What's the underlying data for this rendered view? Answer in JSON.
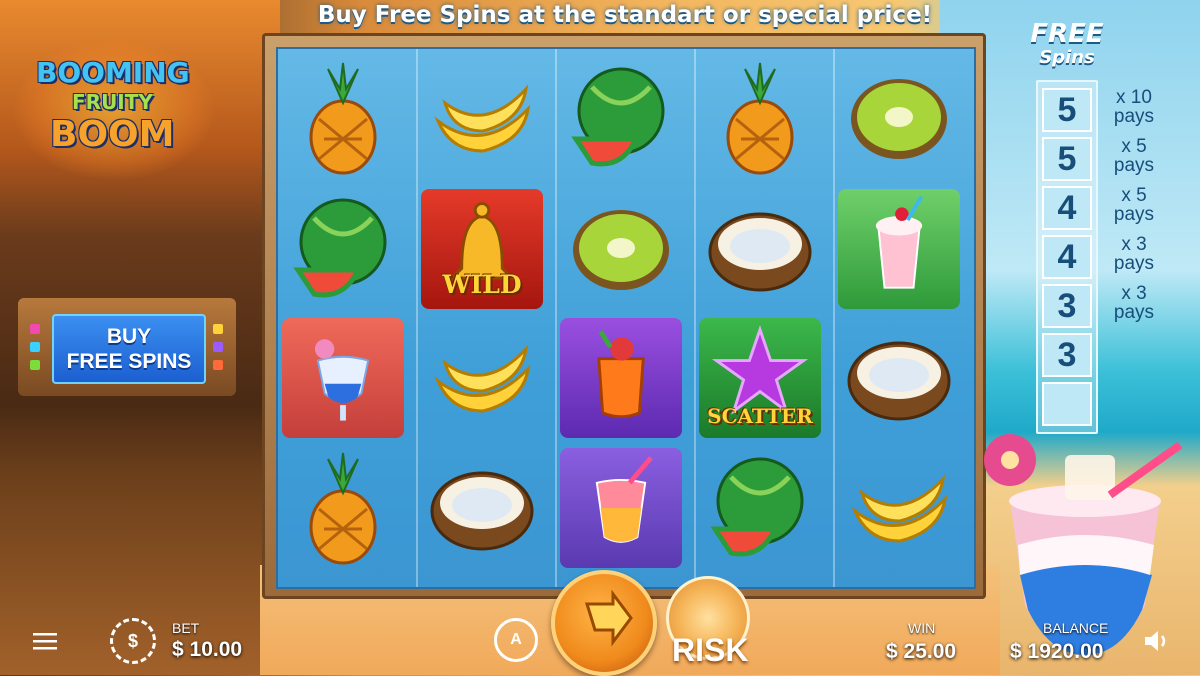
{
  "header": {
    "promo_text": "Buy Free Spins at the standart or special price!"
  },
  "logo": {
    "line1": "BOOMING",
    "line2": "FRUITY",
    "line3": "BOOM"
  },
  "buy_free_spins": {
    "line1": "BUY",
    "line2": "FREE SPINS"
  },
  "free_spins_panel": {
    "title_line1": "FREE",
    "title_line2": "Spins",
    "rungs": [
      "5",
      "5",
      "4",
      "4",
      "3",
      "3",
      ""
    ],
    "pays": [
      {
        "mult": "x 10",
        "label": "pays"
      },
      {
        "mult": "x 5",
        "label": "pays"
      },
      {
        "mult": "x 5",
        "label": "pays"
      },
      {
        "mult": "x 3",
        "label": "pays"
      },
      {
        "mult": "x 3",
        "label": "pays"
      }
    ]
  },
  "reels": [
    [
      "pineapple",
      "watermelon",
      "blue-cocktail",
      "pineapple"
    ],
    [
      "banana",
      "wild-bell",
      "banana",
      "coconut"
    ],
    [
      "watermelon",
      "kiwi",
      "orange-cocktail",
      "pink-cocktail"
    ],
    [
      "pineapple",
      "coconut",
      "scatter-star",
      "watermelon"
    ],
    [
      "kiwi",
      "milkshake",
      "coconut",
      "banana"
    ]
  ],
  "symbol_labels": {
    "wild": "WILD",
    "scatter": "SCATTER"
  },
  "bottom_bar": {
    "bet_label": "BET",
    "bet_value": "$ 10.00",
    "win_label": "WIN",
    "win_value": "$ 25.00",
    "balance_label": "BALANCE",
    "balance_value": "$ 1920.00",
    "risk_label": "RISK",
    "autoplay_letter": "A",
    "chip_symbol": "$"
  },
  "colors": {
    "accent_orange": "#f08a1c",
    "reel_blue": "#3f9fd8",
    "ladder_text": "#174e7a"
  }
}
